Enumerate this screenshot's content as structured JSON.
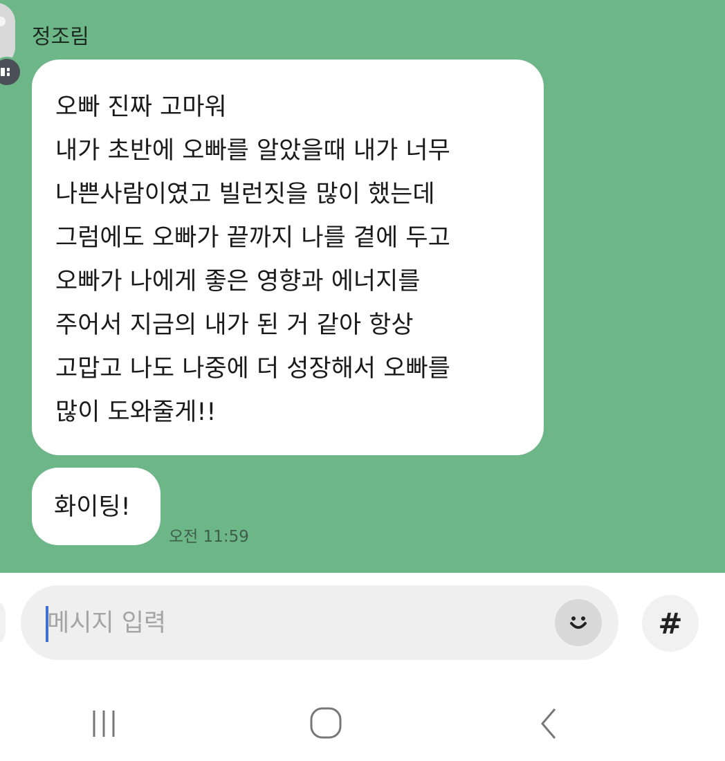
{
  "chat": {
    "sender_name": "정조림",
    "messages": [
      {
        "lines": [
          "오빠 진짜 고마워",
          "내가 초반에 오빠를 알았을때 내가 너무",
          "나쁜사람이였고 빌런짓을 많이 했는데",
          "그럼에도 오빠가 끝까지 나를 곁에 두고",
          "오빠가 나에게 좋은 영향과 에너지를",
          "주어서 지금의 내가 된 거 같아 항상",
          "고맙고 나도 나중에 더 성장해서 오빠를",
          "많이 도와줄게!!"
        ]
      },
      {
        "text": "화이팅!",
        "time": "오전 11:59"
      }
    ]
  },
  "composer": {
    "placeholder": "메시지 입력",
    "value": "",
    "emoji_icon": "smiley-face-icon",
    "hashtag_label": "#"
  },
  "navigation": {
    "recent_apps_icon": "recent-apps-icon",
    "home_icon": "home-icon",
    "back_icon": "back-chevron-icon"
  },
  "colors": {
    "chat_background": "#6db688",
    "bubble_background": "#ffffff",
    "input_background": "#efefef",
    "caret": "#3f6ed4"
  }
}
